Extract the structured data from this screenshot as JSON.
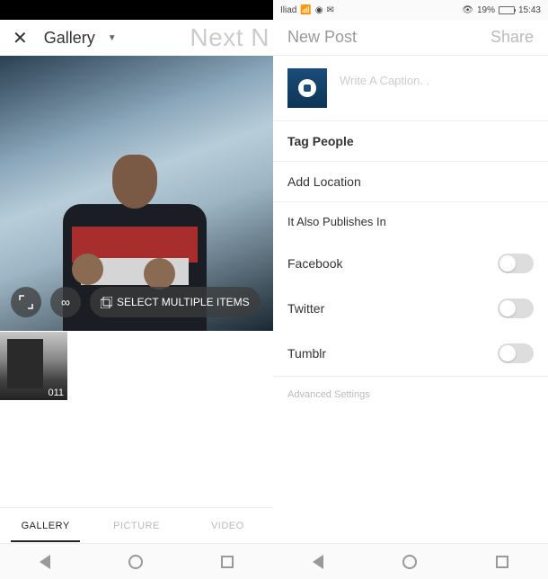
{
  "status_bar": {
    "carrier": "Iliad",
    "battery_percent": "19%",
    "time": "15:43"
  },
  "left": {
    "header": {
      "source": "Gallery",
      "next": "Next N"
    },
    "preview": {
      "select_multiple": "SELECT MULTIPLE ITEMS"
    },
    "thumb": {
      "duration": "011"
    },
    "tabs": {
      "gallery": "GALLERY",
      "picture": "PICTURE",
      "video": "VIDEO"
    }
  },
  "right": {
    "header": {
      "title": "New Post",
      "share": "Share"
    },
    "caption_placeholder": "Write A Caption. .",
    "menu": {
      "tag_people": "Tag People",
      "add_location": "Add Location",
      "also_publish": "It Also Publishes In",
      "facebook": "Facebook",
      "twitter": "Twitter",
      "tumblr": "Tumblr",
      "advanced": "Advanced Settings"
    }
  }
}
